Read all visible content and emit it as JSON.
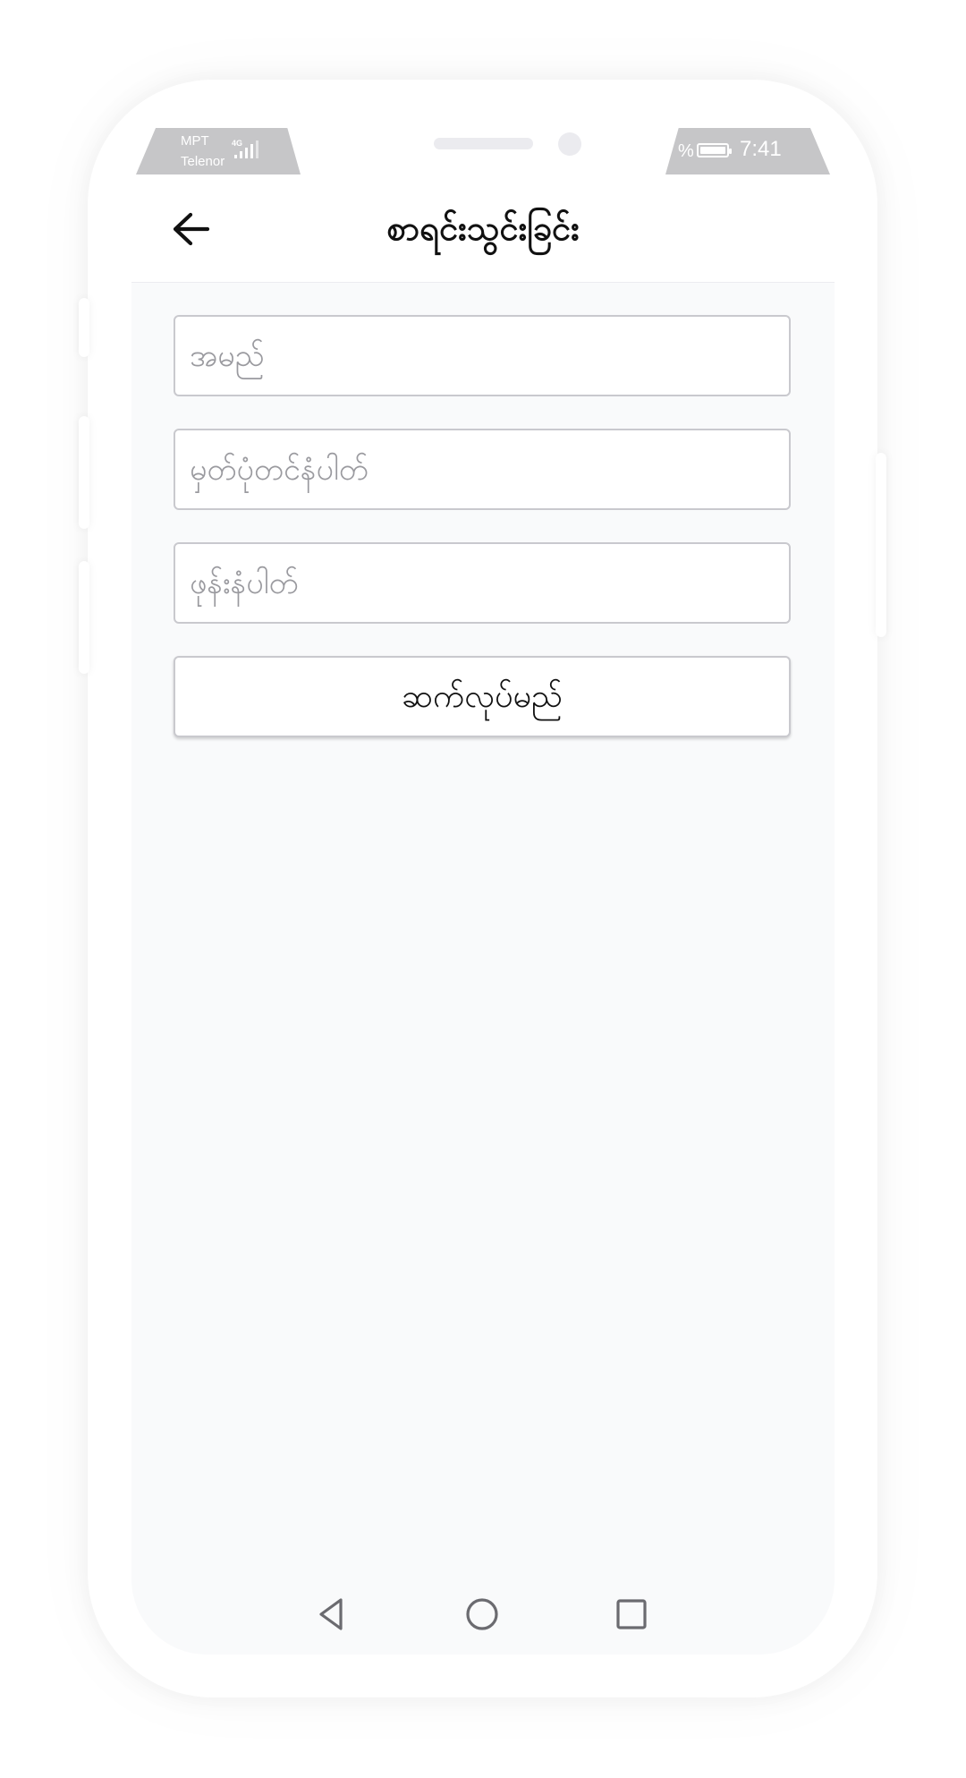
{
  "status_bar": {
    "carrier_1": "MPT",
    "carrier_2": "Telenor",
    "network": "4G",
    "battery_percent_suffix": "%",
    "time": "7:41"
  },
  "header": {
    "title": "စာရင်းသွင်းခြင်း",
    "back_icon": "arrow-left-icon"
  },
  "form": {
    "name_placeholder": "အမည်",
    "nrc_placeholder": "မှတ်ပုံတင်နံပါတ်",
    "phone_placeholder": "ဖုန်းနံပါတ်",
    "continue_label": "ဆက်လုပ်မည်"
  },
  "nav_bar": {
    "back_icon": "triangle-back-icon",
    "home_icon": "circle-home-icon",
    "recents_icon": "square-recents-icon"
  },
  "colors": {
    "screen_background": "#f9fafb",
    "field_border": "#c9c9ce",
    "status_bar": "#c6c6c8",
    "text": "#111111",
    "placeholder": "#9a9a9f"
  }
}
